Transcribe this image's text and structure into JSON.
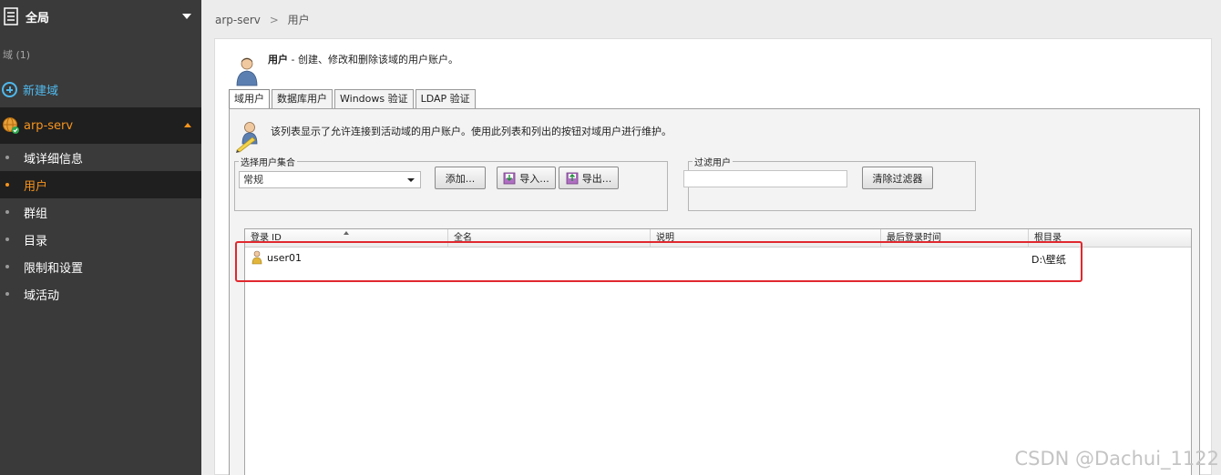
{
  "sidebar": {
    "top_label": "全局",
    "domains_label": "域 (1)",
    "new_domain": "新建域",
    "server": "arp-serv",
    "menu": [
      {
        "label": "域详细信息",
        "active": false
      },
      {
        "label": "用户",
        "active": true
      },
      {
        "label": "群组",
        "active": false
      },
      {
        "label": "目录",
        "active": false
      },
      {
        "label": "限制和设置",
        "active": false
      },
      {
        "label": "域活动",
        "active": false
      }
    ]
  },
  "breadcrumb": {
    "root": "arp-serv",
    "sep": ">",
    "current": "用户"
  },
  "header": {
    "title": "用户",
    "description": " - 创建、修改和删除该域的用户账户。"
  },
  "tabs": [
    "域用户",
    "数据库用户",
    "Windows 验证",
    "LDAP 验证"
  ],
  "info_text": "该列表显示了允许连接到活动域的用户账户。使用此列表和列出的按钮对域用户进行维护。",
  "user_set": {
    "legend": "选择用户集合",
    "selected": "常规",
    "add": "添加...",
    "import": "导入...",
    "export": "导出..."
  },
  "filter": {
    "legend": "过滤用户",
    "value": "",
    "clear": "清除过滤器"
  },
  "table": {
    "columns": [
      "登录 ID",
      "全名",
      "说明",
      "最后登录时间",
      "根目录"
    ],
    "rows": [
      {
        "login_id": "user01",
        "full_name": "",
        "description": "",
        "last_login": "",
        "home": "D:\\壁纸"
      }
    ]
  },
  "watermark": "CSDN @Dachui_1122",
  "colors": {
    "accent": "#f7941d",
    "link": "#4fb8ec",
    "highlight": "#e0282e",
    "sidebar": "#3a3a3a"
  }
}
